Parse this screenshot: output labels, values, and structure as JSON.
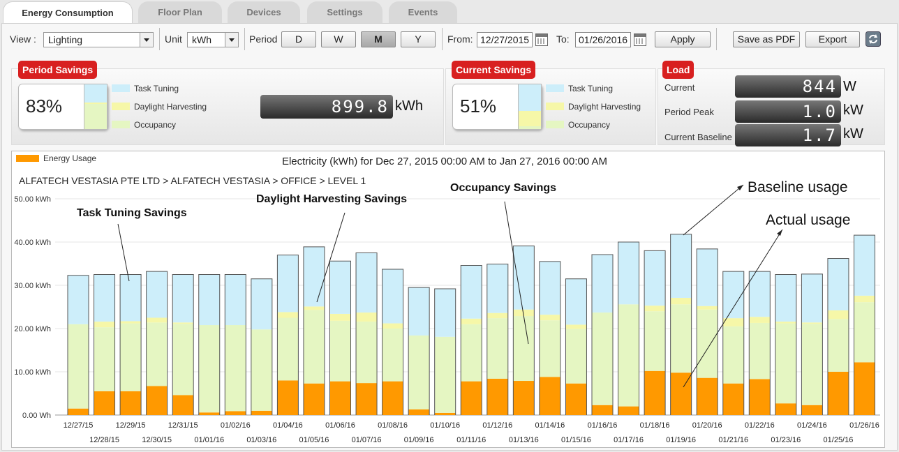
{
  "tabs": [
    {
      "label": "Energy Consumption",
      "active": true
    },
    {
      "label": "Floor Plan",
      "active": false
    },
    {
      "label": "Devices",
      "active": false
    },
    {
      "label": "Settings",
      "active": false
    },
    {
      "label": "Events",
      "active": false
    }
  ],
  "toolbar": {
    "view_label": "View :",
    "view_value": "Lighting",
    "unit_label": "Unit",
    "unit_value": "kWh",
    "period_label": "Period",
    "period_buttons": [
      "D",
      "W",
      "M",
      "Y"
    ],
    "period_selected": "M",
    "from_label": "From:",
    "from_value": "12/27/2015",
    "to_label": "To:",
    "to_value": "01/26/2016",
    "apply_label": "Apply",
    "save_pdf_label": "Save as PDF",
    "export_label": "Export"
  },
  "period_savings": {
    "title": "Period Savings",
    "percent": "83%",
    "value": "899.8",
    "unit": "kWh",
    "legend": [
      "Task Tuning",
      "Daylight Harvesting",
      "Occupancy"
    ]
  },
  "current_savings": {
    "title": "Current Savings",
    "percent": "51%",
    "legend": [
      "Task Tuning",
      "Daylight Harvesting",
      "Occupancy"
    ]
  },
  "load": {
    "title": "Load",
    "rows": [
      {
        "label": "Current",
        "value": "844",
        "unit": "W"
      },
      {
        "label": "Period Peak",
        "value": "1.0",
        "unit": "kW"
      },
      {
        "label": "Current Baseline",
        "value": "1.7",
        "unit": "kW"
      }
    ]
  },
  "colors": {
    "task_tuning": "#cdeefa",
    "daylight": "#f6f7a8",
    "occupancy": "#e5f6c2",
    "energy_usage": "#ff9900",
    "red_tag": "#d82020"
  },
  "chart": {
    "legend": "Energy Usage",
    "title": "Electricity (kWh) for Dec 27, 2015 00:00 AM to Jan 27, 2016 00:00 AM",
    "path": "ALFATECH VESTASIA PTE LTD > ALFATECH VESTASIA > OFFICE > LEVEL 1",
    "annotations": {
      "task": "Task Tuning Savings",
      "daylight": "Daylight Harvesting Savings",
      "occupancy": "Occupancy Savings",
      "baseline": "Baseline usage",
      "actual": "Actual usage"
    }
  },
  "chart_data": {
    "type": "bar",
    "stacked": true,
    "ylim": [
      0,
      50
    ],
    "yticks": [
      "0.00 Wh",
      "10.00 kWh",
      "20.00 kWh",
      "30.00 kWh",
      "40.00 kWh",
      "50.00 kWh"
    ],
    "categories": [
      "12/27/15",
      "12/28/15",
      "12/29/15",
      "12/30/15",
      "12/31/15",
      "01/01/16",
      "01/02/16",
      "01/03/16",
      "01/04/16",
      "01/05/16",
      "01/06/16",
      "01/07/16",
      "01/08/16",
      "01/09/16",
      "01/10/16",
      "01/11/16",
      "01/12/16",
      "01/13/16",
      "01/14/16",
      "01/15/16",
      "01/16/16",
      "01/17/16",
      "01/18/16",
      "01/19/16",
      "01/20/16",
      "01/21/16",
      "01/22/16",
      "01/23/16",
      "01/24/16",
      "01/25/16",
      "01/26/16"
    ],
    "series": [
      {
        "name": "Energy Usage",
        "values": [
          1.5,
          5.5,
          5.5,
          6.7,
          4.6,
          0.6,
          0.9,
          1.0,
          8.0,
          7.3,
          7.8,
          7.4,
          7.8,
          1.3,
          0.5,
          7.8,
          8.4,
          7.9,
          8.8,
          7.3,
          2.3,
          2.0,
          10.2,
          9.8,
          8.6,
          7.3,
          8.3,
          2.7,
          2.3,
          10.0,
          12.2
        ]
      },
      {
        "name": "Occupancy",
        "values": [
          19.5,
          14.8,
          15.7,
          14.7,
          16.5,
          20.2,
          19.9,
          18.8,
          14.5,
          17.0,
          14.0,
          14.2,
          12.2,
          17.1,
          17.6,
          13.2,
          14.0,
          15.0,
          13.1,
          12.6,
          21.4,
          23.6,
          13.8,
          15.8,
          15.8,
          13.2,
          13.0,
          18.5,
          18.8,
          12.2,
          13.9
        ]
      },
      {
        "name": "Daylight Harvesting",
        "values": [
          0,
          1.3,
          0.5,
          1.1,
          0.3,
          0,
          0,
          0,
          1.3,
          0.8,
          1.6,
          2.1,
          1.2,
          0,
          0,
          1.3,
          1.2,
          1.5,
          1.3,
          1.0,
          0,
          0,
          1.3,
          1.5,
          0.8,
          1.9,
          1.4,
          0.4,
          0.3,
          2.0,
          1.5
        ]
      },
      {
        "name": "Task Tuning",
        "values": [
          11.3,
          10.9,
          10.8,
          10.7,
          11.1,
          11.7,
          11.7,
          11.7,
          13.2,
          13.8,
          12.2,
          13.8,
          12.5,
          11.1,
          11.1,
          12.3,
          11.3,
          14.7,
          12.3,
          10.6,
          13.4,
          14.4,
          12.7,
          14.7,
          13.2,
          10.8,
          10.5,
          10.9,
          11.2,
          12.0,
          14.0
        ]
      }
    ]
  }
}
